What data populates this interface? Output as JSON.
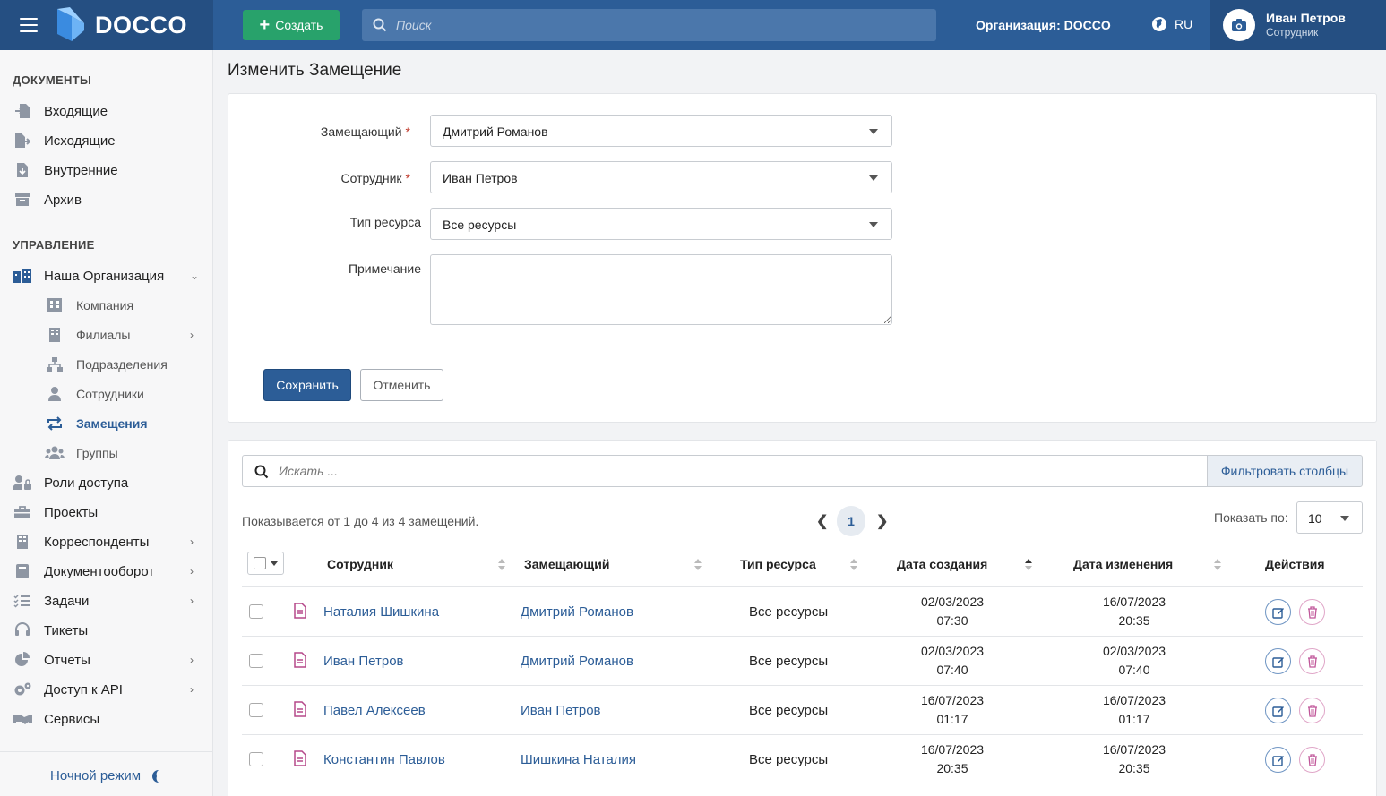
{
  "header": {
    "logo": "DOCCO",
    "create_label": "Создать",
    "search_placeholder": "Поиск",
    "organization": "Организация: DOCCO",
    "language": "RU",
    "user_name": "Иван Петров",
    "user_role": "Сотрудник"
  },
  "sidebar": {
    "section_docs": "ДОКУМЕНТЫ",
    "docs": [
      "Входящие",
      "Исходящие",
      "Внутренние",
      "Архив"
    ],
    "section_mgmt": "УПРАВЛЕНИЕ",
    "org": "Наша Организация",
    "org_sub": [
      "Компания",
      "Филиалы",
      "Подразделения",
      "Сотрудники",
      "Замещения",
      "Группы"
    ],
    "mgmt": [
      "Роли доступа",
      "Проекты",
      "Корреспонденты",
      "Документооборот",
      "Задачи",
      "Тикеты",
      "Отчеты",
      "Доступ к API",
      "Сервисы"
    ],
    "night_mode": "Ночной режим"
  },
  "page": {
    "title": "Изменить Замещение"
  },
  "form": {
    "substitute_label": "Замещающий",
    "substitute_value": "Дмитрий Романов",
    "employee_label": "Сотрудник",
    "employee_value": "Иван Петров",
    "resource_label": "Тип ресурса",
    "resource_value": "Все ресурсы",
    "note_label": "Примечание",
    "note_value": "",
    "save_label": "Сохранить",
    "cancel_label": "Отменить"
  },
  "table": {
    "search_placeholder": "Искать ...",
    "filter_label": "Фильтровать столбцы",
    "showing": "Показывается от 1 до 4 из 4 замещений.",
    "current_page": "1",
    "show_by_label": "Показать по:",
    "page_size": "10",
    "columns": [
      "Сотрудник",
      "Замещающий",
      "Тип ресурса",
      "Дата создания",
      "Дата изменения",
      "Действия"
    ],
    "rows": [
      {
        "employee": "Наталия Шишкина",
        "substitute": "Дмитрий Романов",
        "resource": "Все ресурсы",
        "created_date": "02/03/2023",
        "created_time": "07:30",
        "modified_date": "16/07/2023",
        "modified_time": "20:35"
      },
      {
        "employee": "Иван Петров",
        "substitute": "Дмитрий Романов",
        "resource": "Все ресурсы",
        "created_date": "02/03/2023",
        "created_time": "07:40",
        "modified_date": "02/03/2023",
        "modified_time": "07:40"
      },
      {
        "employee": "Павел Алексеев",
        "substitute": "Иван Петров",
        "resource": "Все ресурсы",
        "created_date": "16/07/2023",
        "created_time": "01:17",
        "modified_date": "16/07/2023",
        "modified_time": "01:17"
      },
      {
        "employee": "Константин Павлов",
        "substitute": "Шишкина Наталия",
        "resource": "Все ресурсы",
        "created_date": "16/07/2023",
        "created_time": "20:35",
        "modified_date": "16/07/2023",
        "modified_time": "20:35"
      }
    ]
  },
  "colors": {
    "header_bg": "#2c5d97",
    "accent": "#2c5d97",
    "create_green": "#28a26b",
    "doc_icon": "#b5488a"
  }
}
